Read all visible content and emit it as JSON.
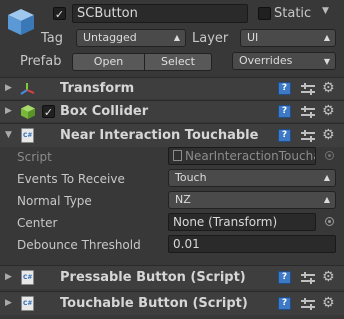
{
  "object": {
    "name": "SCButton",
    "active_checked": "✓",
    "static_label": "Static",
    "tag_label": "Tag",
    "tag_value": "Untagged",
    "layer_label": "Layer",
    "layer_value": "UI",
    "prefab_label": "Prefab",
    "prefab_open": "Open",
    "prefab_select": "Select",
    "prefab_overrides": "Overrides"
  },
  "components": {
    "transform": {
      "title": "Transform"
    },
    "box_collider": {
      "title": "Box Collider",
      "enabled": "✓"
    },
    "near_interaction": {
      "title": "Near Interaction Touchable",
      "script_label": "Script",
      "script_value": "NearInteractionTouchable",
      "events_label": "Events To Receive",
      "events_value": "Touch",
      "normal_label": "Normal Type",
      "normal_value": "NZ",
      "center_label": "Center",
      "center_value": "None (Transform)",
      "debounce_label": "Debounce Threshold",
      "debounce_value": "0.01"
    },
    "pressable_button": {
      "title": "Pressable Button (Script)"
    },
    "touchable_button": {
      "title": "Touchable Button (Script)"
    }
  },
  "icons": {
    "gameobject": "cube-icon",
    "help": "help-book-icon",
    "presets": "presets-icon",
    "settings": "gear-icon"
  },
  "colors": {
    "background": "#383838",
    "field": "#2a2a2a",
    "header": "#3e3e3e",
    "help_blue": "#3d79c4",
    "collider_green": "#7ab83a"
  }
}
